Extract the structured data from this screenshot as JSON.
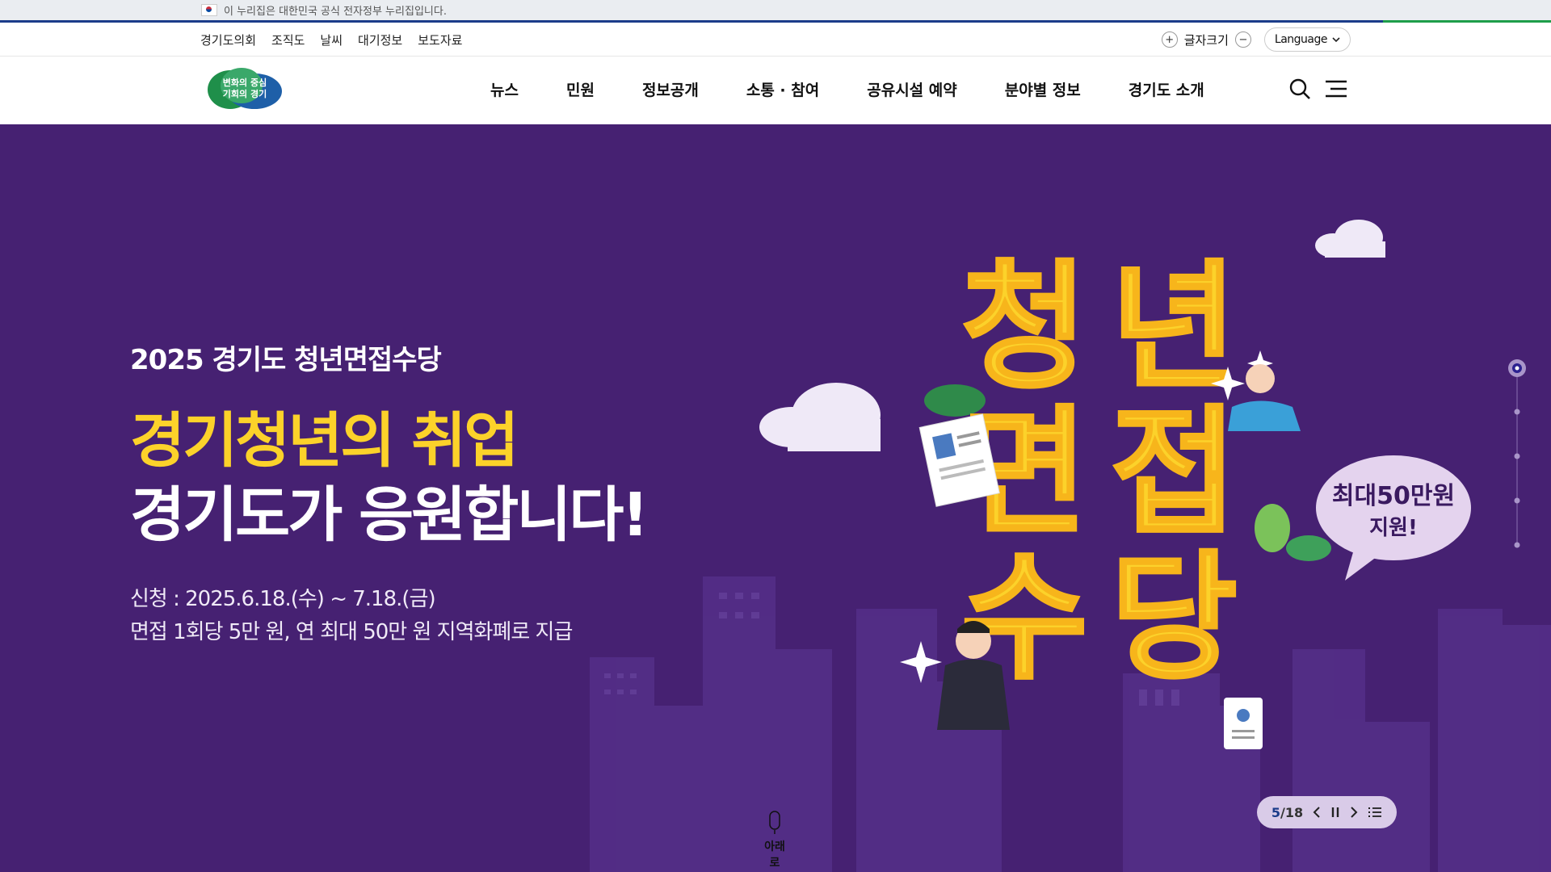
{
  "gov_banner": {
    "text": "이 누리집은 대한민국 공식 전자정부 누리집입니다."
  },
  "util": {
    "links": [
      "경기도의회",
      "조직도",
      "날씨",
      "대기정보",
      "보도자료"
    ],
    "font_size_label": "글자크기",
    "plus_symbol": "+",
    "minus_symbol": "−",
    "language": "Language"
  },
  "header": {
    "logo_lines": [
      "변화의 중심",
      "기회의 경기"
    ],
    "nav": [
      "뉴스",
      "민원",
      "정보공개",
      "소통 · 참여",
      "공유시설 예약",
      "분야별 정보",
      "경기도 소개"
    ]
  },
  "hero": {
    "subtitle": "2025 경기도 청년면접수당",
    "headline_1": "경기청년의 취업",
    "headline_2": "경기도가 응원합니다!",
    "date": "신청 : 2025.6.18.(수) ~ 7.18.(금)",
    "description": "면접 1회당 5만 원, 연 최대 50만 원 지역화폐로 지급",
    "art_title": [
      "청",
      "년",
      "면",
      "접",
      "수",
      "당"
    ],
    "bubble_line_1": "최대50만원",
    "bubble_line_2": "지원!",
    "colors": {
      "background": "#462172",
      "accent": "#fcd22a",
      "bubble": "#e4d3ee"
    }
  },
  "pager": {
    "current": "5",
    "separator": "/",
    "total": "18"
  },
  "scroll_hint": {
    "label": "아래로"
  },
  "icons": [
    "search-icon",
    "menu-icon",
    "chevron-down-icon",
    "prev-icon",
    "pause-icon",
    "next-icon",
    "list-icon",
    "mouse-icon"
  ]
}
